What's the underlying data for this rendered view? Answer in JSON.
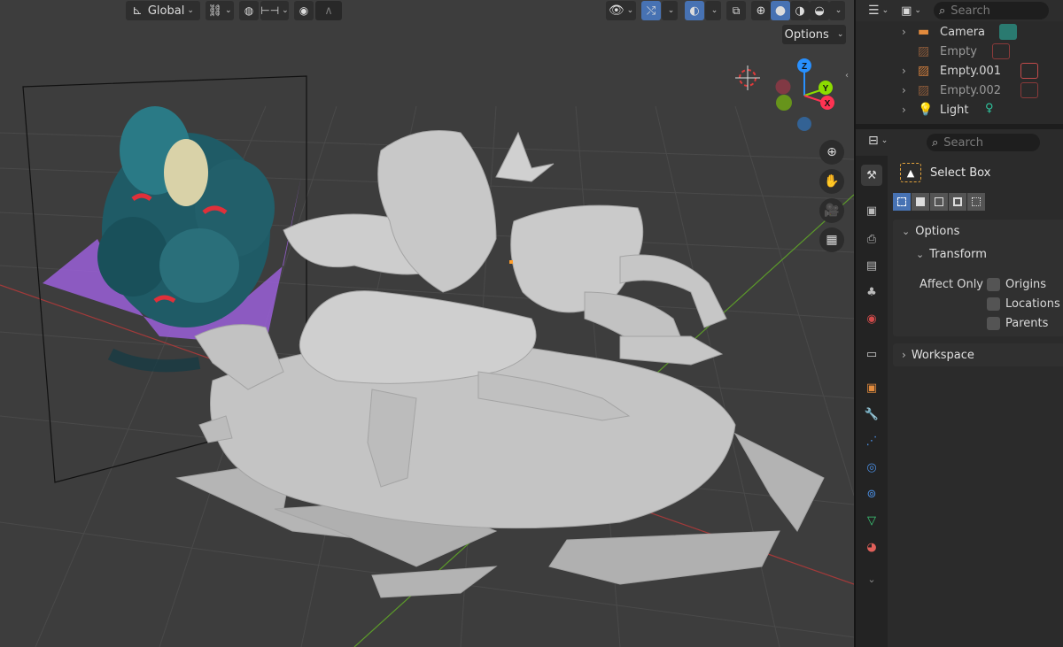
{
  "viewport": {
    "transform_orientation": "Global",
    "options_label": "Options",
    "gizmo_axes": {
      "x": "X",
      "y": "Y",
      "z": "Z"
    },
    "nav_icons": [
      "zoom-icon",
      "hand-pan-icon",
      "camera-view-icon",
      "grid-perspective-icon"
    ]
  },
  "outliner": {
    "search_placeholder": "Search",
    "items": [
      {
        "label": "Camera",
        "dimmed": false
      },
      {
        "label": "Empty",
        "dimmed": true
      },
      {
        "label": "Empty.001",
        "dimmed": false
      },
      {
        "label": "Empty.002",
        "dimmed": true
      },
      {
        "label": "Light",
        "dimmed": false
      }
    ]
  },
  "properties": {
    "search_placeholder": "Search",
    "tool_name": "Select Box",
    "options_panel": "Options",
    "transform_panel": "Transform",
    "affect_only_label": "Affect Only",
    "checkboxes": [
      "Origins",
      "Locations",
      "Parents"
    ],
    "workspace_panel": "Workspace"
  },
  "colors": {
    "accent": "#4772b3",
    "axis_x": "#ff3352",
    "axis_y": "#8bdc00",
    "axis_z": "#2890ff",
    "camera_icon": "#e38b3d",
    "light_icon": "#f0a63c"
  }
}
